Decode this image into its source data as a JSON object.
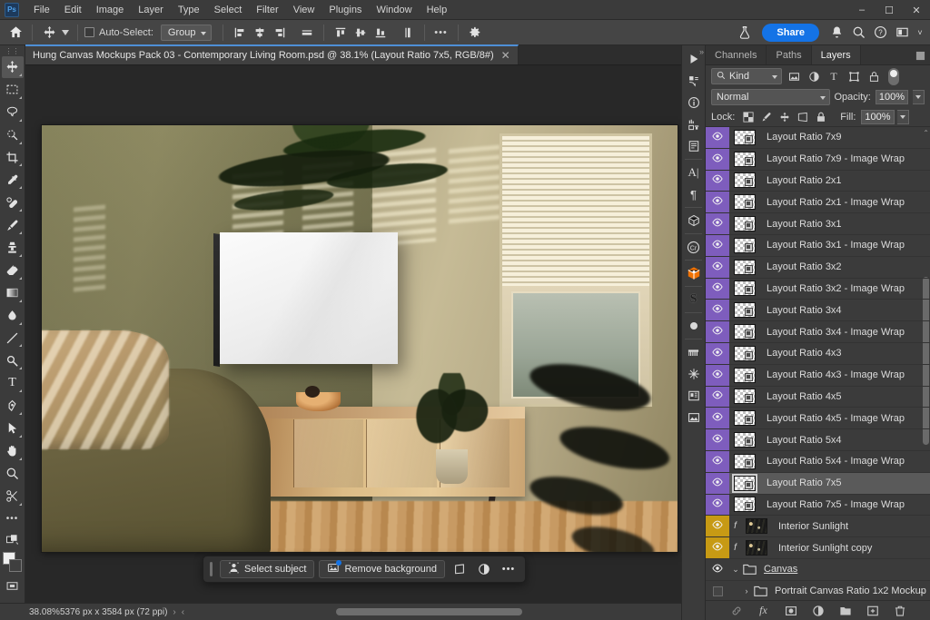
{
  "app": {
    "name": "Photoshop",
    "logo_text": "Ps"
  },
  "menubar": {
    "items": [
      "File",
      "Edit",
      "Image",
      "Layer",
      "Type",
      "Select",
      "Filter",
      "View",
      "Plugins",
      "Window",
      "Help"
    ],
    "window_controls": {
      "minimize": "–",
      "maximize": "☐",
      "close": "✕"
    }
  },
  "options_bar": {
    "home_icon": "home-icon",
    "tool_icon": "move-tool-icon",
    "auto_select_label": "Auto-Select:",
    "auto_select_checked": false,
    "group_value": "Group",
    "align_icons": [
      "align-left-edges",
      "align-horizontal-centers",
      "align-right-edges",
      "distribute-horizontal"
    ],
    "align_icons2": [
      "align-top-edges",
      "align-vertical-centers",
      "align-bottom-edges",
      "distribute-vertical"
    ],
    "more_label": "•••",
    "settings_icon": "gear-icon",
    "lab_icon": "flask-icon",
    "share_label": "Share",
    "bell_icon": "bell-icon",
    "search_icon": "search-icon",
    "help_icon": "help-icon",
    "workspace_icon": "workspace-icon",
    "chevron": "˅"
  },
  "toolbar": {
    "tools": [
      {
        "name": "move-tool",
        "glyph": "✤",
        "active": true,
        "has_corner": true
      },
      {
        "name": "rectangular-marquee-tool",
        "glyph": "⬚",
        "active": false,
        "has_corner": true
      },
      {
        "name": "lasso-tool",
        "glyph": "☂",
        "active": false,
        "has_corner": true
      },
      {
        "name": "object-selection-tool",
        "glyph": "❁",
        "active": false,
        "has_corner": true
      },
      {
        "name": "crop-tool",
        "glyph": "⛏",
        "active": false,
        "has_corner": true
      },
      {
        "name": "eyedropper-tool",
        "glyph": "✐",
        "active": false,
        "has_corner": true
      },
      {
        "name": "spot-healing-brush-tool",
        "glyph": "✒",
        "active": false,
        "has_corner": true
      },
      {
        "name": "brush-tool",
        "glyph": "✎",
        "active": false,
        "has_corner": true
      },
      {
        "name": "clone-stamp-tool",
        "glyph": "✇",
        "active": false,
        "has_corner": true
      },
      {
        "name": "eraser-tool",
        "glyph": "◿",
        "active": false,
        "has_corner": true
      },
      {
        "name": "gradient-tool",
        "glyph": "▧",
        "active": false,
        "has_corner": true
      },
      {
        "name": "blur-tool",
        "glyph": "◖",
        "active": false,
        "has_corner": true
      },
      {
        "name": "line-tool",
        "glyph": "╱",
        "active": false,
        "has_corner": true
      },
      {
        "name": "dodge-tool",
        "glyph": "◍",
        "active": false,
        "has_corner": true
      },
      {
        "name": "type-tool",
        "glyph": "T",
        "active": false,
        "has_corner": true
      },
      {
        "name": "pen-tool",
        "glyph": "✒",
        "active": false,
        "has_corner": true
      },
      {
        "name": "path-selection-tool",
        "glyph": "➤",
        "active": false,
        "has_corner": true
      },
      {
        "name": "hand-tool",
        "glyph": "✋",
        "active": false,
        "has_corner": true
      },
      {
        "name": "zoom-tool",
        "glyph": "⌕",
        "active": false,
        "has_corner": false
      },
      {
        "name": "edit-toolbar",
        "glyph": "✂",
        "active": false,
        "has_corner": true
      }
    ],
    "more_tools": "•••",
    "foreground_color": "#efefef",
    "background_color": "#3f3f3f",
    "quick_mask_icon": "quick-mask-icon",
    "screen_mode_icon": "screen-mode-icon"
  },
  "document": {
    "tab_title": "Hung Canvas Mockups Pack 03 - Contemporary Living Room.psd @ 38.1% (Layout Ratio 7x5, RGB/8#)",
    "close_glyph": "✕"
  },
  "contextual_task_bar": {
    "select_subject_label": "Select subject",
    "select_subject_icon": "person-select-icon",
    "remove_background_label": "Remove background",
    "remove_background_icon": "image-ai-icon",
    "transform_icon": "transform-icon",
    "adjust_icon": "adjustment-icon",
    "more_icon": "•••"
  },
  "status_bar": {
    "zoom": "38.08%",
    "dimensions": "5376 px x 3584 px (72 ppi)",
    "arrow_right": "›",
    "arrow_left": "‹"
  },
  "right_rail": {
    "icons": [
      "play-icon",
      "actions-icon",
      "info-icon",
      "histogram-brush-icon",
      "notes-icon",
      "character-icon",
      "paragraph-icon",
      "3d-icon",
      "creative-cloud-icon",
      "plugins-box-icon",
      "substance-icon",
      "dot-icon",
      "comb-icon",
      "snowflake-icon",
      "libraries-icon",
      "adjustments-icon"
    ]
  },
  "panel": {
    "tabs": [
      {
        "label": "Channels",
        "active": false
      },
      {
        "label": "Paths",
        "active": false
      },
      {
        "label": "Layers",
        "active": true
      }
    ],
    "menu_icon": "panel-menu-icon",
    "filter": {
      "search_icon": "search-icon",
      "kind_label": "Kind",
      "type_filters": [
        "pixel-filter-icon",
        "adjustment-filter-icon",
        "type-filter-icon",
        "shape-filter-icon",
        "smart-object-filter-icon"
      ],
      "toggle_on": true
    },
    "blend_mode": "Normal",
    "opacity_label": "Opacity:",
    "opacity_value": "100%",
    "lock_label": "Lock:",
    "lock_icons": [
      "lock-transparent-pixels",
      "lock-image-pixels",
      "lock-position",
      "lock-artboard-nesting",
      "lock-all"
    ],
    "fill_label": "Fill:",
    "fill_value": "100%",
    "layers": [
      {
        "name": "Layout Ratio 7x9",
        "visible": true,
        "eye_color": "purple",
        "thumb": "smart-object",
        "selected": false
      },
      {
        "name": "Layout Ratio 7x9 - Image Wrap",
        "visible": true,
        "eye_color": "purple",
        "thumb": "smart-object",
        "selected": false
      },
      {
        "name": "Layout Ratio 2x1",
        "visible": true,
        "eye_color": "purple",
        "thumb": "smart-object",
        "selected": false
      },
      {
        "name": "Layout Ratio 2x1 - Image Wrap",
        "visible": true,
        "eye_color": "purple",
        "thumb": "smart-object",
        "selected": false
      },
      {
        "name": "Layout Ratio 3x1",
        "visible": true,
        "eye_color": "purple",
        "thumb": "smart-object",
        "selected": false
      },
      {
        "name": "Layout Ratio 3x1 - Image Wrap",
        "visible": true,
        "eye_color": "purple",
        "thumb": "smart-object",
        "selected": false
      },
      {
        "name": "Layout Ratio 3x2",
        "visible": true,
        "eye_color": "purple",
        "thumb": "smart-object",
        "selected": false
      },
      {
        "name": "Layout Ratio 3x2 - Image Wrap",
        "visible": true,
        "eye_color": "purple",
        "thumb": "smart-object",
        "selected": false
      },
      {
        "name": "Layout Ratio 3x4",
        "visible": true,
        "eye_color": "purple",
        "thumb": "smart-object",
        "selected": false
      },
      {
        "name": "Layout Ratio 3x4 - Image Wrap",
        "visible": true,
        "eye_color": "purple",
        "thumb": "smart-object",
        "selected": false
      },
      {
        "name": "Layout Ratio 4x3",
        "visible": true,
        "eye_color": "purple",
        "thumb": "smart-object",
        "selected": false
      },
      {
        "name": "Layout Ratio 4x3 - Image Wrap",
        "visible": true,
        "eye_color": "purple",
        "thumb": "smart-object",
        "selected": false
      },
      {
        "name": "Layout Ratio 4x5",
        "visible": true,
        "eye_color": "purple",
        "thumb": "smart-object",
        "selected": false
      },
      {
        "name": "Layout Ratio 4x5 - Image Wrap",
        "visible": true,
        "eye_color": "purple",
        "thumb": "smart-object",
        "selected": false
      },
      {
        "name": "Layout Ratio 5x4",
        "visible": true,
        "eye_color": "purple",
        "thumb": "smart-object",
        "selected": false
      },
      {
        "name": "Layout Ratio 5x4 - Image Wrap",
        "visible": true,
        "eye_color": "purple",
        "thumb": "smart-object",
        "selected": false
      },
      {
        "name": "Layout Ratio 7x5",
        "visible": true,
        "eye_color": "purple",
        "thumb": "smart-object",
        "selected": true
      },
      {
        "name": "Layout Ratio 7x5 - Image Wrap",
        "visible": true,
        "eye_color": "purple",
        "thumb": "smart-object",
        "selected": false
      },
      {
        "name": "Interior Sunlight",
        "visible": true,
        "eye_color": "gold",
        "thumb": "photo",
        "selected": false,
        "has_fx": true
      },
      {
        "name": "Interior Sunlight copy",
        "visible": true,
        "eye_color": "gold",
        "thumb": "photo",
        "selected": false,
        "has_fx": true
      },
      {
        "name": "Canvas",
        "visible": true,
        "eye_color": "plain",
        "thumb": "group",
        "selected": false,
        "is_group": true,
        "expanded": true
      },
      {
        "name": "Portrait Canvas Ratio 1x2 Mockup",
        "visible": false,
        "eye_color": "plain",
        "thumb": "group",
        "selected": false,
        "is_group": true,
        "expanded": false,
        "indent": true
      }
    ],
    "footer_icons": [
      "link-layers-icon",
      "layer-style-fx-icon",
      "add-layer-mask-icon",
      "new-adjustment-layer-icon",
      "new-group-icon",
      "new-layer-icon",
      "delete-layer-icon"
    ]
  },
  "colors": {
    "accent_blue": "#1473e6",
    "layer_purple": "#7e5dbd",
    "layer_gold": "#c79a14",
    "panel_bg": "#3b3b3b",
    "canvas_bg": "#282828"
  }
}
